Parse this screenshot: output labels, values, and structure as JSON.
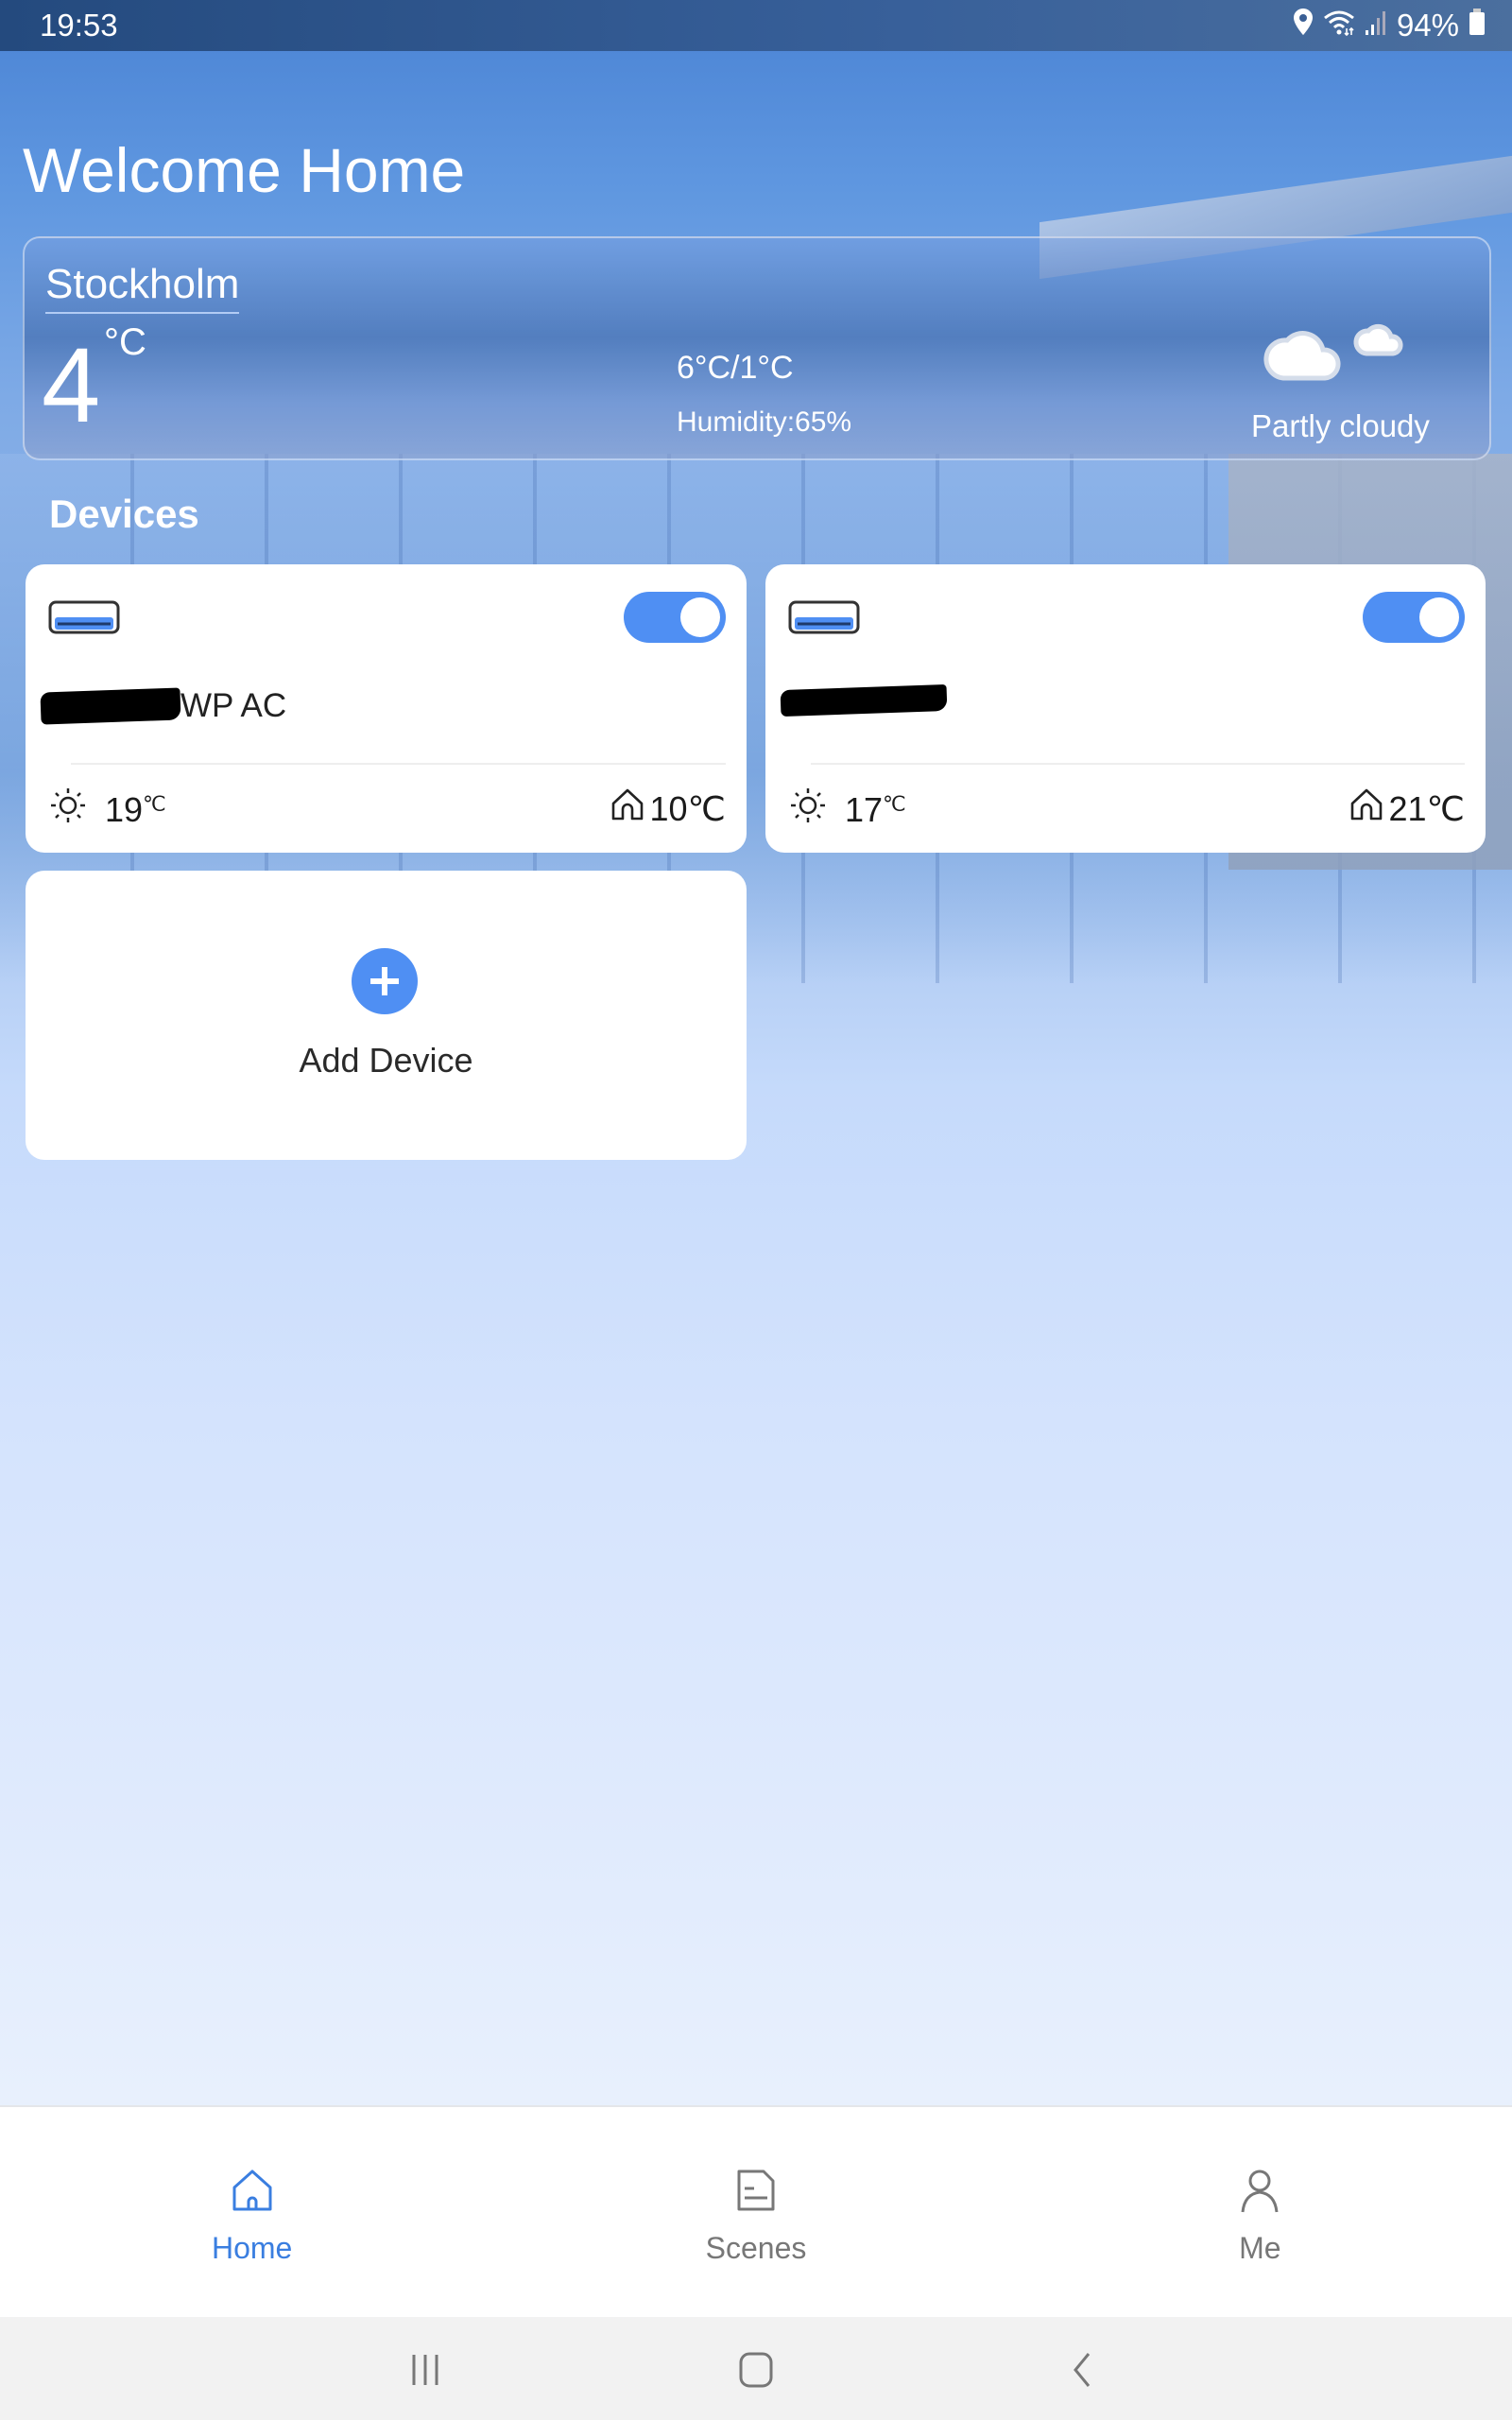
{
  "status_bar": {
    "time": "19:53",
    "battery": "94%",
    "icons": [
      "location-icon",
      "wifi-icon",
      "signal-icon",
      "battery-icon"
    ]
  },
  "header": {
    "title": "Welcome Home"
  },
  "weather": {
    "city": "Stockholm",
    "temperature": "4",
    "unit": "°C",
    "high_low": "6°C/1°C",
    "humidity": "Humidity:65%",
    "condition": "Partly cloudy",
    "icon": "partly-cloudy-night-icon"
  },
  "devices_section": {
    "title": "Devices"
  },
  "devices": [
    {
      "name_visible_suffix": "WP AC",
      "name_redacted": true,
      "power_on": true,
      "outdoor_temp": "19",
      "outdoor_unit": "℃",
      "indoor_temp": "10℃"
    },
    {
      "name_visible_suffix": "",
      "name_redacted": true,
      "power_on": true,
      "outdoor_temp": "17",
      "outdoor_unit": "℃",
      "indoor_temp": "21℃"
    }
  ],
  "add_device": {
    "label": "Add Device"
  },
  "bottom_nav": {
    "items": [
      {
        "label": "Home",
        "icon": "home-icon",
        "active": true
      },
      {
        "label": "Scenes",
        "icon": "scenes-icon",
        "active": false
      },
      {
        "label": "Me",
        "icon": "person-icon",
        "active": false
      }
    ]
  },
  "colors": {
    "accent": "#4f8ff3",
    "active_nav": "#3a7ee0",
    "inactive_nav": "#777777",
    "moon": "#e8d900"
  }
}
